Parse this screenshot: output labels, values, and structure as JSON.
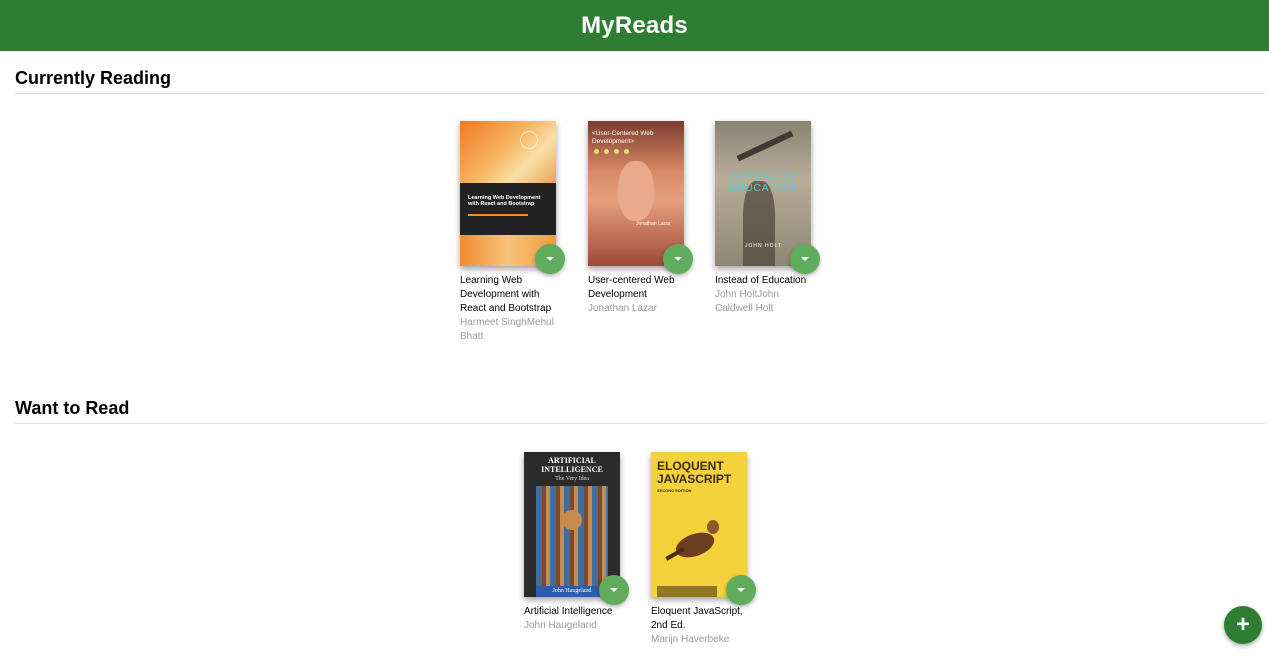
{
  "header": {
    "title": "MyReads"
  },
  "shelves": [
    {
      "title": "Currently Reading",
      "books": [
        {
          "title": "Learning Web Development with React and Bootstrap",
          "authors": "Harmeet SinghMehul Bhatt",
          "cover_color": "#f08a30"
        },
        {
          "title": "User-centered Web Development",
          "authors": "Jonathan Lazar",
          "cover_color": "#c9714f"
        },
        {
          "title": "Instead of Education",
          "authors": "John HoltJohn Caldwell Holt",
          "cover_color": "#9f9583"
        }
      ]
    },
    {
      "title": "Want to Read",
      "books": [
        {
          "title": "Artificial Intelligence",
          "authors": "John Haugeland",
          "cover_color": "#2b2b2b"
        },
        {
          "title": "Eloquent JavaScript, 2nd Ed.",
          "authors": "Marijn Haverbeke",
          "cover_color": "#f5d13c"
        }
      ]
    }
  ],
  "covers": {
    "react": {
      "title": "Learning Web Development with React and Bootstrap"
    },
    "ucwd": {
      "title": "<User-Centered Web Development>",
      "author": "Jonathan Lazar"
    },
    "instead": {
      "title": "INSTEAD OF EDUCATION",
      "author": "JOHN HOLT"
    },
    "ai": {
      "title": "ARTIFICIAL INTELLIGENCE",
      "subtitle": "The Very Idea",
      "author": "John Haugeland"
    },
    "eloquent": {
      "title": "ELOQUENT JAVASCRIPT",
      "edition": "SECOND EDITION"
    }
  },
  "icons": {
    "changer": "arrow-drop-down-icon",
    "add": "plus-icon"
  },
  "colors": {
    "header": "#2e7d32",
    "changer": "#60ac5d",
    "add_button": "#2e7d32",
    "authors": "#999999"
  }
}
